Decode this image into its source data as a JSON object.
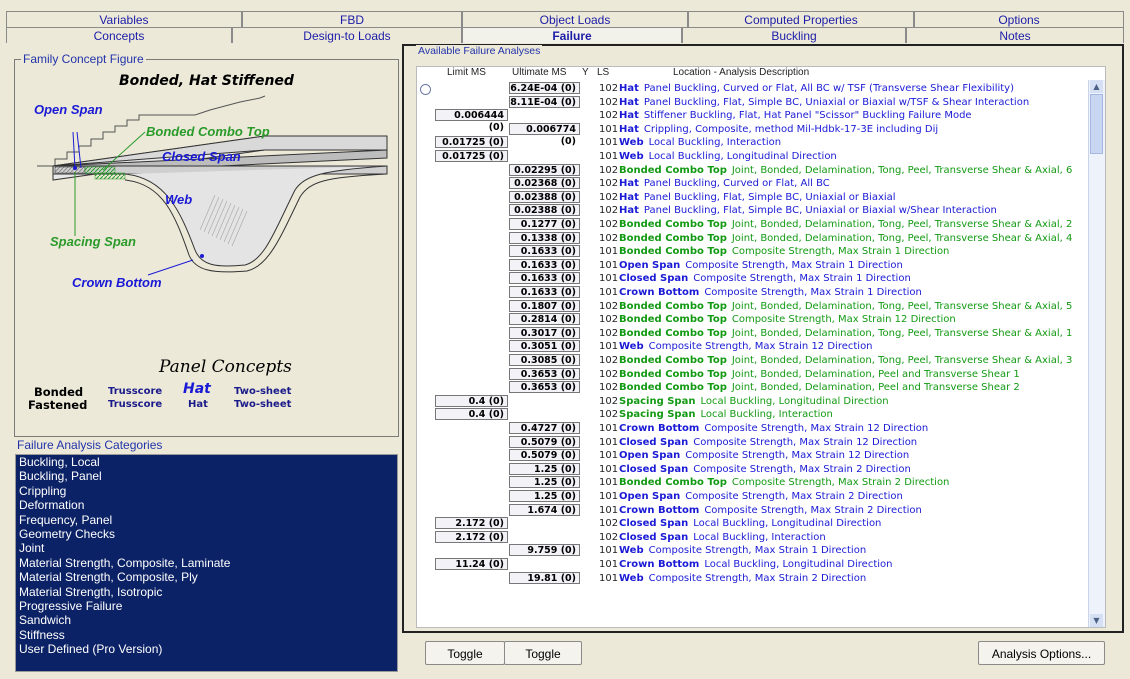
{
  "tabs_row1": [
    "Variables",
    "FBD",
    "Object Loads",
    "Computed Properties",
    "Options"
  ],
  "tabs_row2": [
    "Concepts",
    "Design-to Loads",
    "Failure",
    "Buckling",
    "Notes"
  ],
  "family": {
    "legend": "Family Concept Figure",
    "title": "Bonded, Hat Stiffened",
    "labels": {
      "open_span": "Open Span",
      "bonded_combo_top": "Bonded Combo Top",
      "closed_span": "Closed Span",
      "web": "Web",
      "spacing_span": "Spacing Span",
      "crown_bottom": "Crown Bottom"
    },
    "panel_concepts": "Panel Concepts",
    "concepts_grid": {
      "row1": [
        "Bonded",
        "Trusscore",
        "Hat",
        "Two-sheet"
      ],
      "row2": [
        "Fastened",
        "Trusscore",
        "Hat",
        "Two-sheet"
      ]
    }
  },
  "categories": {
    "legend": "Failure Analysis Categories",
    "items": [
      "Buckling, Local",
      "Buckling, Panel",
      "Crippling",
      "Deformation",
      "Frequency, Panel",
      "Geometry Checks",
      "Joint",
      "Material Strength, Composite, Laminate",
      "Material Strength, Composite, Ply",
      "Material Strength, Isotropic",
      "Progressive Failure",
      "Sandwich",
      "Stiffness",
      "User Defined (Pro Version)"
    ]
  },
  "analyses": {
    "legend": "Available Failure Analyses",
    "headers": {
      "limit": "Limit MS",
      "ultimate": "Ultimate MS",
      "y": "Y",
      "ls": "LS",
      "desc": "Location - Analysis Description"
    },
    "rows": [
      {
        "limit": "",
        "ultimate": "6.24E-04 (0)",
        "ls": "102",
        "loc": "Hat",
        "desc": "Panel Buckling, Curved or Flat, All BC w/ TSF (Transverse Shear Flexibility)",
        "color": "#1a1ad6"
      },
      {
        "limit": "",
        "ultimate": "8.11E-04 (0)",
        "ls": "102",
        "loc": "Hat",
        "desc": "Panel Buckling, Flat, Simple BC, Uniaxial or Biaxial w/TSF & Shear Interaction",
        "color": "#1a1ad6"
      },
      {
        "limit": "0.006444 (0)",
        "ultimate": "",
        "ls": "102",
        "loc": "Hat",
        "desc": "Stiffener Buckling, Flat, Hat Panel \"Scissor\" Buckling Failure Mode",
        "color": "#1a1ad6"
      },
      {
        "limit": "",
        "ultimate": "0.006774 (0)",
        "ls": "101",
        "loc": "Hat",
        "desc": "Crippling, Composite, method Mil-Hdbk-17-3E including Dij",
        "color": "#1a1ad6"
      },
      {
        "limit": "0.01725 (0)",
        "ultimate": "",
        "ls": "101",
        "loc": "Web",
        "desc": "Local Buckling, Interaction",
        "color": "#1a1ad6"
      },
      {
        "limit": "0.01725 (0)",
        "ultimate": "",
        "ls": "101",
        "loc": "Web",
        "desc": "Local Buckling, Longitudinal Direction",
        "color": "#1a1ad6"
      },
      {
        "limit": "",
        "ultimate": "0.02295 (0)",
        "ls": "102",
        "loc": "Bonded Combo Top",
        "desc": "Joint, Bonded, Delamination, Tong, Peel, Transverse Shear & Axial, 6",
        "color": "#139a13"
      },
      {
        "limit": "",
        "ultimate": "0.02368 (0)",
        "ls": "102",
        "loc": "Hat",
        "desc": "Panel Buckling, Curved or Flat, All BC",
        "color": "#1a1ad6"
      },
      {
        "limit": "",
        "ultimate": "0.02388 (0)",
        "ls": "102",
        "loc": "Hat",
        "desc": "Panel Buckling, Flat, Simple BC, Uniaxial or Biaxial",
        "color": "#1a1ad6"
      },
      {
        "limit": "",
        "ultimate": "0.02388 (0)",
        "ls": "102",
        "loc": "Hat",
        "desc": "Panel Buckling, Flat, Simple BC, Uniaxial or Biaxial w/Shear Interaction",
        "color": "#1a1ad6"
      },
      {
        "limit": "",
        "ultimate": "0.1277 (0)",
        "ls": "102",
        "loc": "Bonded Combo Top",
        "desc": "Joint, Bonded, Delamination, Tong, Peel, Transverse Shear & Axial, 2",
        "color": "#139a13"
      },
      {
        "limit": "",
        "ultimate": "0.1338 (0)",
        "ls": "102",
        "loc": "Bonded Combo Top",
        "desc": "Joint, Bonded, Delamination, Tong, Peel, Transverse Shear & Axial, 4",
        "color": "#139a13"
      },
      {
        "limit": "",
        "ultimate": "0.1633 (0)",
        "ls": "101",
        "loc": "Bonded Combo Top",
        "desc": "Composite Strength, Max Strain 1 Direction",
        "color": "#139a13"
      },
      {
        "limit": "",
        "ultimate": "0.1633 (0)",
        "ls": "101",
        "loc": "Open Span",
        "desc": "Composite Strength, Max Strain 1 Direction",
        "color": "#1a1ad6"
      },
      {
        "limit": "",
        "ultimate": "0.1633 (0)",
        "ls": "101",
        "loc": "Closed Span",
        "desc": "Composite Strength, Max Strain 1 Direction",
        "color": "#1a1ad6"
      },
      {
        "limit": "",
        "ultimate": "0.1633 (0)",
        "ls": "101",
        "loc": "Crown Bottom",
        "desc": "Composite Strength, Max Strain 1 Direction",
        "color": "#1a1ad6"
      },
      {
        "limit": "",
        "ultimate": "0.1807 (0)",
        "ls": "102",
        "loc": "Bonded Combo Top",
        "desc": "Joint, Bonded, Delamination, Tong, Peel, Transverse Shear & Axial, 5",
        "color": "#139a13"
      },
      {
        "limit": "",
        "ultimate": "0.2814 (0)",
        "ls": "102",
        "loc": "Bonded Combo Top",
        "desc": "Composite Strength, Max Strain 12 Direction",
        "color": "#139a13"
      },
      {
        "limit": "",
        "ultimate": "0.3017 (0)",
        "ls": "102",
        "loc": "Bonded Combo Top",
        "desc": "Joint, Bonded, Delamination, Tong, Peel, Transverse Shear & Axial, 1",
        "color": "#139a13"
      },
      {
        "limit": "",
        "ultimate": "0.3051 (0)",
        "ls": "101",
        "loc": "Web",
        "desc": "Composite Strength, Max Strain 12 Direction",
        "color": "#1a1ad6"
      },
      {
        "limit": "",
        "ultimate": "0.3085 (0)",
        "ls": "102",
        "loc": "Bonded Combo Top",
        "desc": "Joint, Bonded, Delamination, Tong, Peel, Transverse Shear & Axial, 3",
        "color": "#139a13"
      },
      {
        "limit": "",
        "ultimate": "0.3653 (0)",
        "ls": "102",
        "loc": "Bonded Combo Top",
        "desc": "Joint, Bonded, Delamination, Peel and Transverse Shear 1",
        "color": "#139a13"
      },
      {
        "limit": "",
        "ultimate": "0.3653 (0)",
        "ls": "102",
        "loc": "Bonded Combo Top",
        "desc": "Joint, Bonded, Delamination, Peel and Transverse Shear 2",
        "color": "#139a13"
      },
      {
        "limit": "0.4 (0)",
        "ultimate": "",
        "ls": "102",
        "loc": "Spacing Span",
        "desc": "Local Buckling, Longitudinal Direction",
        "color": "#139a13"
      },
      {
        "limit": "0.4 (0)",
        "ultimate": "",
        "ls": "102",
        "loc": "Spacing Span",
        "desc": "Local Buckling, Interaction",
        "color": "#139a13"
      },
      {
        "limit": "",
        "ultimate": "0.4727 (0)",
        "ls": "101",
        "loc": "Crown Bottom",
        "desc": "Composite Strength, Max Strain 12 Direction",
        "color": "#1a1ad6"
      },
      {
        "limit": "",
        "ultimate": "0.5079 (0)",
        "ls": "101",
        "loc": "Closed Span",
        "desc": "Composite Strength, Max Strain 12 Direction",
        "color": "#1a1ad6"
      },
      {
        "limit": "",
        "ultimate": "0.5079 (0)",
        "ls": "101",
        "loc": "Open Span",
        "desc": "Composite Strength, Max Strain 12 Direction",
        "color": "#1a1ad6"
      },
      {
        "limit": "",
        "ultimate": "1.25 (0)",
        "ls": "101",
        "loc": "Closed Span",
        "desc": "Composite Strength, Max Strain 2 Direction",
        "color": "#1a1ad6"
      },
      {
        "limit": "",
        "ultimate": "1.25 (0)",
        "ls": "101",
        "loc": "Bonded Combo Top",
        "desc": "Composite Strength, Max Strain 2 Direction",
        "color": "#139a13"
      },
      {
        "limit": "",
        "ultimate": "1.25 (0)",
        "ls": "101",
        "loc": "Open Span",
        "desc": "Composite Strength, Max Strain 2 Direction",
        "color": "#1a1ad6"
      },
      {
        "limit": "",
        "ultimate": "1.674 (0)",
        "ls": "101",
        "loc": "Crown Bottom",
        "desc": "Composite Strength, Max Strain 2 Direction",
        "color": "#1a1ad6"
      },
      {
        "limit": "2.172 (0)",
        "ultimate": "",
        "ls": "102",
        "loc": "Closed Span",
        "desc": "Local Buckling, Longitudinal Direction",
        "color": "#1a1ad6"
      },
      {
        "limit": "2.172 (0)",
        "ultimate": "",
        "ls": "102",
        "loc": "Closed Span",
        "desc": "Local Buckling, Interaction",
        "color": "#1a1ad6"
      },
      {
        "limit": "",
        "ultimate": "9.759 (0)",
        "ls": "101",
        "loc": "Web",
        "desc": "Composite Strength, Max Strain 1 Direction",
        "color": "#1a1ad6"
      },
      {
        "limit": "11.24 (0)",
        "ultimate": "",
        "ls": "101",
        "loc": "Crown Bottom",
        "desc": "Local Buckling, Longitudinal Direction",
        "color": "#1a1ad6"
      },
      {
        "limit": "",
        "ultimate": "19.81 (0)",
        "ls": "101",
        "loc": "Web",
        "desc": "Composite Strength, Max Strain 2 Direction",
        "color": "#1a1ad6"
      }
    ]
  },
  "buttons": {
    "toggle1": "Toggle",
    "toggle2": "Toggle",
    "analysis_options": "Analysis Options..."
  }
}
